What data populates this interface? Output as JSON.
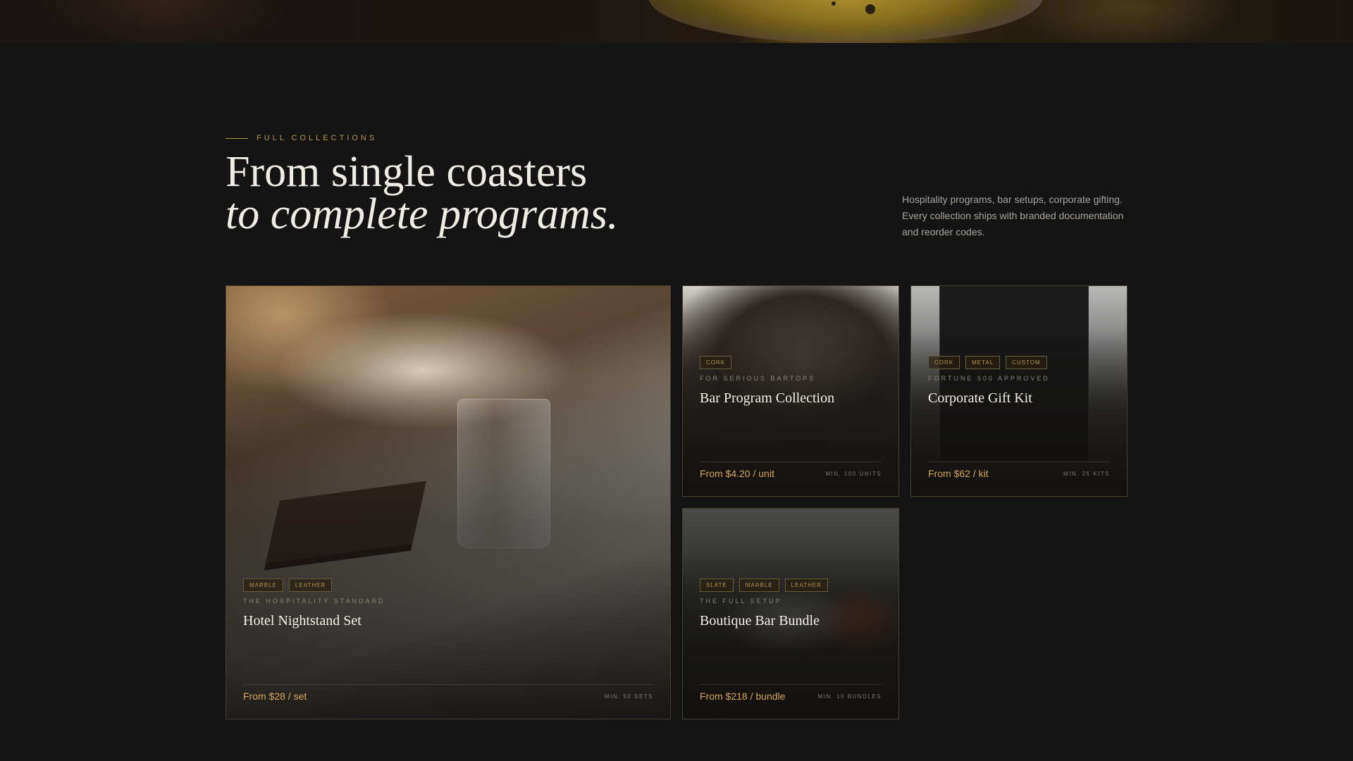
{
  "section": {
    "eyebrow": "FULL COLLECTIONS",
    "headline_line1": "From single coasters",
    "headline_line2": "to complete programs.",
    "intro": "Hospitality programs, bar setups, corporate gifting. Every collection ships with branded documentation and reorder codes."
  },
  "colors": {
    "background": "#141414",
    "accent_gold": "#b8954a",
    "price": "#d4a55a"
  },
  "collections": [
    {
      "tags": [
        "MARBLE",
        "LEATHER"
      ],
      "kicker": "THE HOSPITALITY STANDARD",
      "title": "Hotel Nightstand Set",
      "price": "From $28 / set",
      "minimum": "MIN. 50 SETS"
    },
    {
      "tags": [
        "CORK"
      ],
      "kicker": "FOR SERIOUS BARTOPS",
      "title": "Bar Program Collection",
      "price": "From $4.20 / unit",
      "minimum": "MIN. 100 UNITS"
    },
    {
      "tags": [
        "CORK",
        "METAL",
        "CUSTOM"
      ],
      "kicker": "FORTUNE 500 APPROVED",
      "title": "Corporate Gift Kit",
      "price": "From $62 / kit",
      "minimum": "MIN. 25 KITS"
    },
    {
      "tags": [
        "SLATE",
        "MARBLE",
        "LEATHER"
      ],
      "kicker": "THE FULL SETUP",
      "title": "Boutique Bar Bundle",
      "price": "From $218 / bundle",
      "minimum": "MIN. 10 BUNDLES"
    }
  ]
}
